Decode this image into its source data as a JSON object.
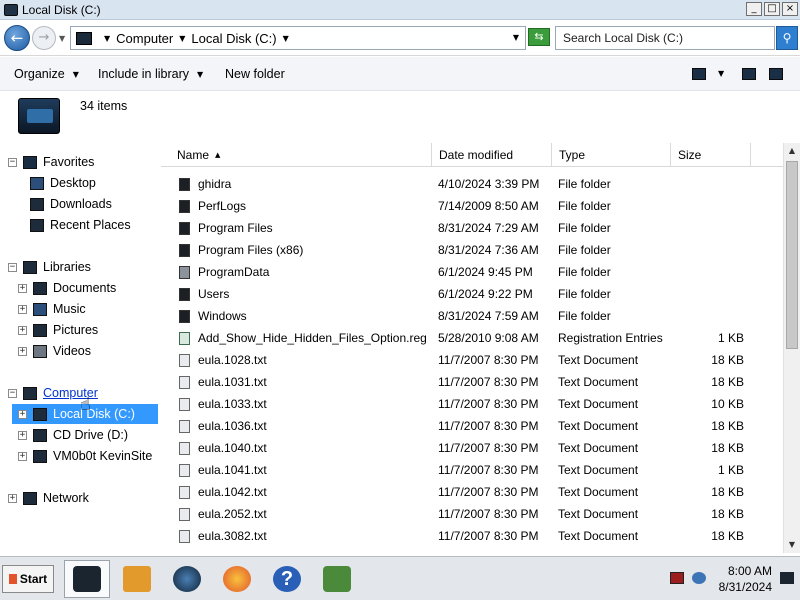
{
  "window": {
    "title": "Local Disk (C:)",
    "minimize_glyph": "_",
    "maximize_glyph": "□",
    "close_glyph": "×"
  },
  "address": {
    "back_glyph": "←",
    "forward_glyph": "→",
    "crumbs": [
      "Computer",
      "Local Disk (C:)"
    ],
    "search_placeholder": "Search Local Disk (C:)"
  },
  "toolbar": {
    "organize": "Organize",
    "include_in_library": "Include in library",
    "new_folder": "New folder"
  },
  "info": {
    "items_count": "34 items"
  },
  "navigation": {
    "favorites": "Favorites",
    "favorites_items": [
      "Desktop",
      "Downloads",
      "Recent Places"
    ],
    "libraries": "Libraries",
    "libraries_items": [
      "Documents",
      "Music",
      "Pictures",
      "Videos"
    ],
    "computer": "Computer",
    "computer_items": [
      "Local Disk (C:)",
      "CD Drive (D:)",
      "VM0b0t KevinSite"
    ],
    "network": "Network"
  },
  "columns": {
    "name": "Name",
    "date_modified": "Date modified",
    "type": "Type",
    "size": "Size"
  },
  "files": [
    {
      "name": "ghidra",
      "date": "4/10/2024 3:39 PM",
      "type": "File folder",
      "size": "",
      "icon": "folder"
    },
    {
      "name": "PerfLogs",
      "date": "7/14/2009 8:50 AM",
      "type": "File folder",
      "size": "",
      "icon": "folder"
    },
    {
      "name": "Program Files",
      "date": "8/31/2024 7:29 AM",
      "type": "File folder",
      "size": "",
      "icon": "folder"
    },
    {
      "name": "Program Files (x86)",
      "date": "8/31/2024 7:36 AM",
      "type": "File folder",
      "size": "",
      "icon": "folder"
    },
    {
      "name": "ProgramData",
      "date": "6/1/2024 9:45 PM",
      "type": "File folder",
      "size": "",
      "icon": "folder-light"
    },
    {
      "name": "Users",
      "date": "6/1/2024 9:22 PM",
      "type": "File folder",
      "size": "",
      "icon": "folder"
    },
    {
      "name": "Windows",
      "date": "8/31/2024 7:59 AM",
      "type": "File folder",
      "size": "",
      "icon": "folder"
    },
    {
      "name": "Add_Show_Hide_Hidden_Files_Option.reg",
      "date": "5/28/2010 9:08 AM",
      "type": "Registration Entries",
      "size": "1 KB",
      "icon": "reg"
    },
    {
      "name": "eula.1028.txt",
      "date": "11/7/2007 8:30 PM",
      "type": "Text Document",
      "size": "18 KB",
      "icon": "doc"
    },
    {
      "name": "eula.1031.txt",
      "date": "11/7/2007 8:30 PM",
      "type": "Text Document",
      "size": "18 KB",
      "icon": "doc"
    },
    {
      "name": "eula.1033.txt",
      "date": "11/7/2007 8:30 PM",
      "type": "Text Document",
      "size": "10 KB",
      "icon": "doc"
    },
    {
      "name": "eula.1036.txt",
      "date": "11/7/2007 8:30 PM",
      "type": "Text Document",
      "size": "18 KB",
      "icon": "doc"
    },
    {
      "name": "eula.1040.txt",
      "date": "11/7/2007 8:30 PM",
      "type": "Text Document",
      "size": "18 KB",
      "icon": "doc"
    },
    {
      "name": "eula.1041.txt",
      "date": "11/7/2007 8:30 PM",
      "type": "Text Document",
      "size": "1 KB",
      "icon": "doc"
    },
    {
      "name": "eula.1042.txt",
      "date": "11/7/2007 8:30 PM",
      "type": "Text Document",
      "size": "18 KB",
      "icon": "doc"
    },
    {
      "name": "eula.2052.txt",
      "date": "11/7/2007 8:30 PM",
      "type": "Text Document",
      "size": "18 KB",
      "icon": "doc"
    },
    {
      "name": "eula.3082.txt",
      "date": "11/7/2007 8:30 PM",
      "type": "Text Document",
      "size": "18 KB",
      "icon": "doc"
    }
  ],
  "taskbar": {
    "start": "Start",
    "apps": [
      "file-explorer-icon",
      "media-player-icon",
      "globe-icon",
      "firefox-icon",
      "help-icon",
      "app-checklist-icon"
    ],
    "clock_time": "8:00 AM",
    "clock_date": "8/31/2024"
  },
  "colors": {
    "selection": "#3399ff",
    "titlebar": "#d9e4f1",
    "link": "#0033cc"
  }
}
